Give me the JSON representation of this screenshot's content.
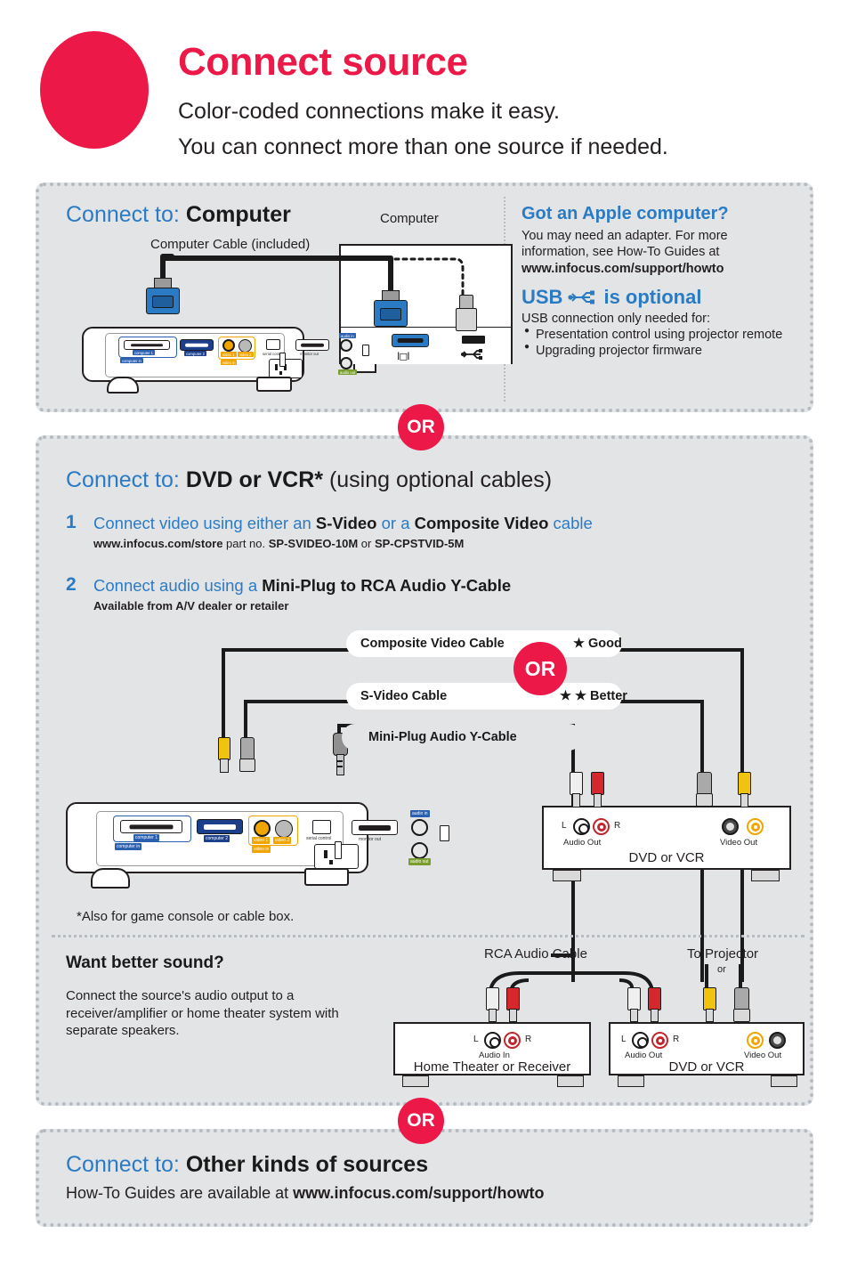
{
  "header": {
    "title": "Connect source",
    "subtitle_line1": "Color-coded connections make it easy.",
    "subtitle_line2": "You can connect more than one source if needed."
  },
  "colors": {
    "brand_red": "#ec1847",
    "brand_blue": "#2b7bc4",
    "panel_bg": "#e2e4e6",
    "dotted_border": "#b5bcc3",
    "text": "#231f20"
  },
  "or_badges": {
    "label": "OR"
  },
  "section_computer": {
    "heading_prefix": "Connect to:",
    "heading_strong": "Computer",
    "computer_label": "Computer",
    "cable_label": "Computer Cable (included)",
    "monitor_port_icon": "monitor-port-icon",
    "usb_port_icon": "usb-port-icon",
    "apple": {
      "heading": "Got an Apple computer?",
      "body": "You may need an adapter. For more information, see How-To Guides at",
      "url": "www.infocus.com/support/howto"
    },
    "usb": {
      "heading_pre": "USB",
      "heading_post": "is optional",
      "icon": "usb-icon",
      "intro": "USB connection only needed for:",
      "bullets": [
        "Presentation control using projector remote",
        "Upgrading projector firmware"
      ]
    },
    "projector_panel_labels": {
      "computer1": "computer 1",
      "computer2": "computer 2",
      "computer_in": "computer in",
      "video1": "video 1",
      "video2": "video 2",
      "video_in": "video in",
      "serial_control": "serial control",
      "monitor_out": "monitor out",
      "audio_in": "audio in",
      "audio_out": "audio out"
    }
  },
  "section_dvd": {
    "heading_prefix": "Connect to:",
    "heading_strong": "DVD or VCR*",
    "heading_suffix": "(using optional cables)",
    "steps": [
      {
        "number": "1",
        "text_pre": "Connect video using either an ",
        "text_b1": "S-Video",
        "text_mid": " or a ",
        "text_b2": "Composite Video",
        "text_post": " cable",
        "sub_pre": "www.infocus.com/store",
        "sub_mid": " part no. ",
        "sub_b1": "SP-SVIDEO-10M",
        "sub_or": " or ",
        "sub_b2": "SP-CPSTVID-5M"
      },
      {
        "number": "2",
        "text_pre": "Connect audio using a ",
        "text_b1": "Mini-Plug to RCA Audio Y-Cable",
        "sub": "Available from A/V dealer or retailer"
      }
    ],
    "cable_labels": [
      {
        "name": "Composite Video Cable",
        "rating": "★   Good"
      },
      {
        "name": "S-Video Cable",
        "rating": "★ ★  Better"
      },
      {
        "name": "Mini-Plug Audio Y-Cable",
        "rating": ""
      }
    ],
    "device": {
      "name": "DVD or VCR",
      "audio_out": "Audio Out",
      "video_out": "Video Out",
      "left": "L",
      "right": "R"
    },
    "footnote": "*Also for game console or cable box."
  },
  "section_sound": {
    "heading": "Want better sound?",
    "body": "Connect the source's audio output to a receiver/amplifier or home theater system with separate speakers.",
    "rca_cable_label": "RCA Audio Cable",
    "to_projector": "To Projector",
    "or_small": "or",
    "home_theater": {
      "name": "Home Theater or Receiver",
      "audio_in": "Audio In",
      "left": "L",
      "right": "R"
    },
    "dvd": {
      "name": "DVD or VCR",
      "audio_out": "Audio Out",
      "video_out": "Video Out",
      "left": "L",
      "right": "R"
    }
  },
  "section_other": {
    "heading_prefix": "Connect to:",
    "heading_strong": "Other kinds of sources",
    "sub_pre": "How-To Guides are available at ",
    "sub_url": "www.infocus.com/support/howto"
  }
}
